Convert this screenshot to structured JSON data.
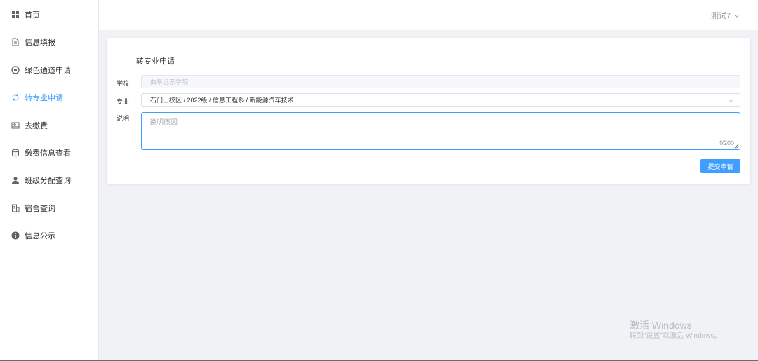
{
  "sidebar": {
    "items": [
      {
        "label": "首页",
        "icon": "grid-icon",
        "active": false
      },
      {
        "label": "信息填报",
        "icon": "document-icon",
        "active": false
      },
      {
        "label": "绿色通道申请",
        "icon": "circle-plus-icon",
        "active": false
      },
      {
        "label": "转专业申请",
        "icon": "refresh-icon",
        "active": true
      },
      {
        "label": "去缴费",
        "icon": "payment-card-icon",
        "active": false
      },
      {
        "label": "缴费信息查看",
        "icon": "database-icon",
        "active": false
      },
      {
        "label": "班级分配查询",
        "icon": "user-icon",
        "active": false
      },
      {
        "label": "宿舍查询",
        "icon": "building-icon",
        "active": false
      },
      {
        "label": "信息公示",
        "icon": "info-icon",
        "active": false
      }
    ]
  },
  "header": {
    "user_name": "测试7"
  },
  "form": {
    "title": "转专业申请",
    "school_label": "学校",
    "school_value": "曲阜远东学院",
    "major_label": "专业",
    "major_value": "石门山校区 / 2022级 / 信息工程系 / 新能源汽车技术",
    "reason_label": "说明",
    "reason_placeholder": "说明原因",
    "reason_counter": "4/200",
    "submit_label": "提交申请"
  },
  "watermark": {
    "title": "激活 Windows",
    "subtitle": "转到\"设置\"以激活 Windows。"
  },
  "colors": {
    "accent": "#409eff",
    "background": "#f0f2f5"
  }
}
